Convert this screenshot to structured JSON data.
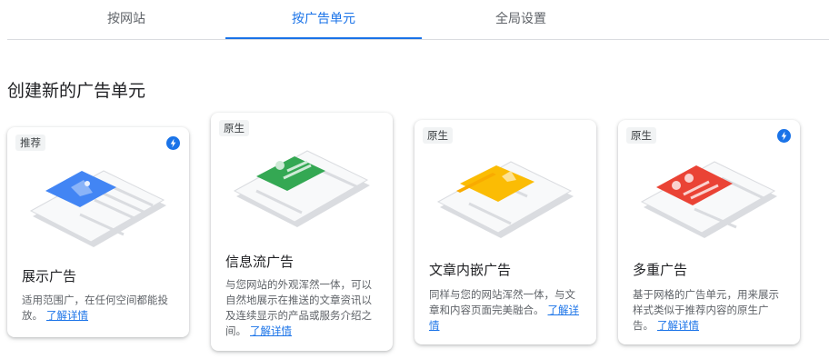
{
  "tabs": [
    {
      "label": "按网站"
    },
    {
      "label": "按广告单元"
    },
    {
      "label": "全局设置"
    }
  ],
  "active_tab": "按广告单元",
  "section_title": "创建新的广告单元",
  "colors": {
    "accent": "#1a73e8",
    "green": "#34a853",
    "yellow": "#fbbc04",
    "red": "#ea4335",
    "blue": "#4285f4"
  },
  "cards": [
    {
      "badge": "推荐",
      "title": "展示广告",
      "desc": "适用范围广，在任何空间都能投放。",
      "link": "了解详情",
      "bolt_icon": "bolt-icon"
    },
    {
      "badge": "原生",
      "title": "信息流广告",
      "desc": "与您网站的外观浑然一体，可以自然地展示在推送的文章资讯以及连续显示的产品或服务介绍之间。",
      "link": "了解详情"
    },
    {
      "badge": "原生",
      "title": "文章内嵌广告",
      "desc": "同样与您的网站浑然一体，与文章和内容页面完美融合。",
      "link": "了解详情"
    },
    {
      "badge": "原生",
      "title": "多重广告",
      "desc": "基于网格的广告单元，用来展示样式类似于推荐内容的原生广告。",
      "link": "了解详情",
      "bolt_icon": "bolt-icon"
    }
  ]
}
